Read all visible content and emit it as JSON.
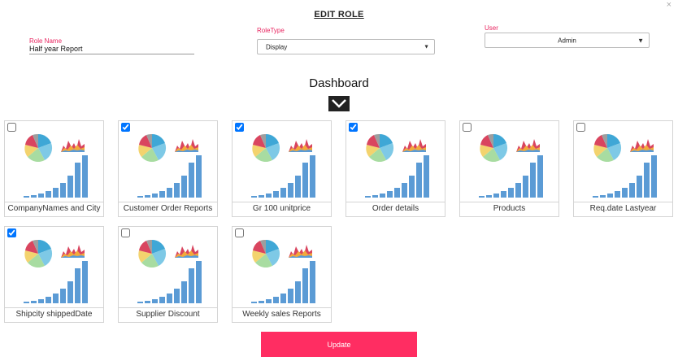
{
  "dialog": {
    "title": "EDIT ROLE",
    "close_symbol": "×"
  },
  "role_name": {
    "label": "Role Name",
    "value": "Half year Report"
  },
  "role_type": {
    "label": "RoleType",
    "value": "Display"
  },
  "user": {
    "label": "User",
    "value": "Admin"
  },
  "dashboard": {
    "title": "Dashboard",
    "reports": [
      {
        "name": "CompanyNames and City",
        "checked": false
      },
      {
        "name": "Customer Order Reports",
        "checked": true
      },
      {
        "name": "Gr 100 unitprice",
        "checked": true
      },
      {
        "name": "Order details",
        "checked": true
      },
      {
        "name": "Products",
        "checked": false
      },
      {
        "name": "Req.date Lastyear",
        "checked": false
      },
      {
        "name": "Shipcity shippedDate",
        "checked": true
      },
      {
        "name": "Supplier Discount",
        "checked": false
      },
      {
        "name": "Weekly sales Reports",
        "checked": false
      }
    ]
  },
  "actions": {
    "update_label": "Update"
  },
  "colors": {
    "accent": "#ff2d62",
    "label": "#e8245f",
    "bar": "#5b9bd5"
  }
}
